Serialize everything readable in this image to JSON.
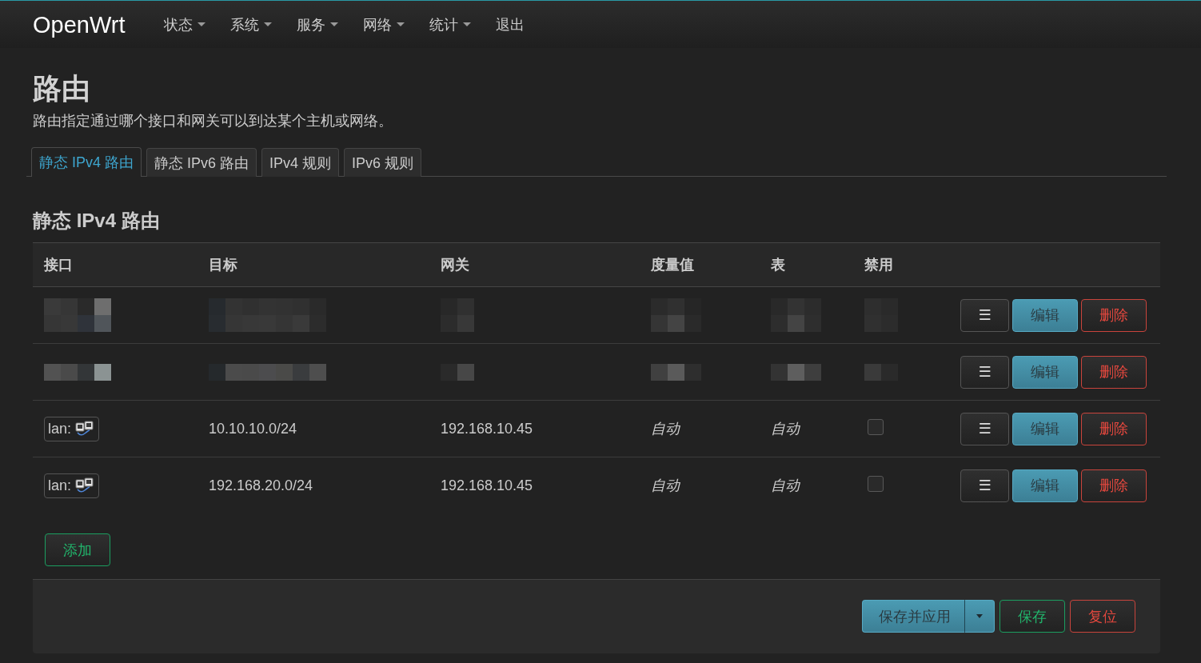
{
  "header": {
    "brand": "OpenWrt",
    "menu": [
      {
        "label": "状态",
        "dropdown": true
      },
      {
        "label": "系统",
        "dropdown": true
      },
      {
        "label": "服务",
        "dropdown": true
      },
      {
        "label": "网络",
        "dropdown": true
      },
      {
        "label": "统计",
        "dropdown": true
      },
      {
        "label": "退出",
        "dropdown": false
      }
    ]
  },
  "page": {
    "title": "路由",
    "description": "路由指定通过哪个接口和网关可以到达某个主机或网络。"
  },
  "tabs": [
    {
      "label": "静态 IPv4 路由",
      "selected": true
    },
    {
      "label": "静态 IPv6 路由",
      "selected": false
    },
    {
      "label": "IPv4 规则",
      "selected": false
    },
    {
      "label": "IPv6 规则",
      "selected": false
    }
  ],
  "section": {
    "title": "静态 IPv4 路由",
    "table": {
      "columns": [
        "接口",
        "目标",
        "网关",
        "度量值",
        "表",
        "禁用"
      ],
      "rows": [
        {
          "kind": "redacted",
          "actions": [
            {
              "kind": "more",
              "label": "☰"
            },
            {
              "kind": "edit",
              "label": "编辑"
            },
            {
              "kind": "delete",
              "label": "删除"
            }
          ]
        },
        {
          "kind": "redacted",
          "actions": [
            {
              "kind": "more",
              "label": "☰"
            },
            {
              "kind": "edit",
              "label": "编辑"
            },
            {
              "kind": "delete",
              "label": "删除"
            }
          ]
        },
        {
          "kind": "route",
          "interface": "lan:",
          "target": "10.10.10.0/24",
          "gateway": "192.168.10.45",
          "metric": "自动",
          "table": "自动",
          "disabled": false,
          "actions": [
            {
              "kind": "more",
              "label": "☰"
            },
            {
              "kind": "edit",
              "label": "编辑"
            },
            {
              "kind": "delete",
              "label": "删除"
            }
          ]
        },
        {
          "kind": "route",
          "interface": "lan:",
          "target": "192.168.20.0/24",
          "gateway": "192.168.10.45",
          "metric": "自动",
          "table": "自动",
          "disabled": false,
          "actions": [
            {
              "kind": "more",
              "label": "☰"
            },
            {
              "kind": "edit",
              "label": "编辑"
            },
            {
              "kind": "delete",
              "label": "删除"
            }
          ]
        }
      ]
    },
    "add_button": "添加"
  },
  "footer": {
    "buttons": [
      {
        "kind": "apply",
        "label": "保存并应用"
      },
      {
        "kind": "save",
        "label": "保存"
      },
      {
        "kind": "reset",
        "label": "复位"
      }
    ]
  }
}
